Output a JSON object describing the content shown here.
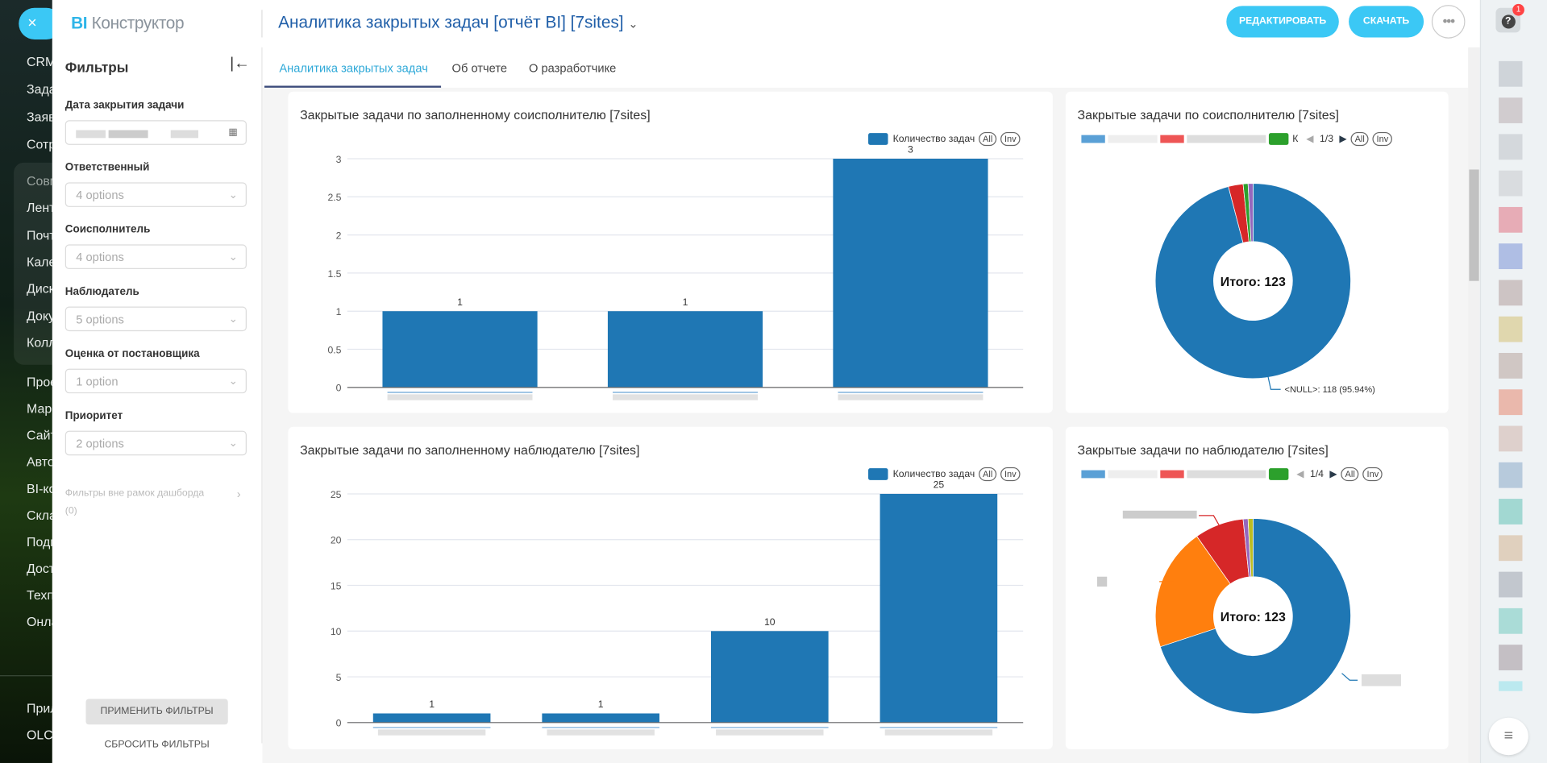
{
  "leftnav": {
    "items_top": [
      "CRM",
      "Задачи",
      "Заявки",
      "Сотрудники"
    ],
    "group": [
      "Совместная",
      "Лента",
      "Почта",
      "Календарь",
      "Диск",
      "Документы",
      "Коллабы"
    ],
    "items": [
      "Проекты",
      "Маркетинг",
      "Сайты",
      "Автоматизация",
      "BI-конструктор",
      "Склад",
      "Подписка",
      "Достижения",
      "Техподдержка",
      "Онлайн"
    ],
    "bottom": [
      "Приложения",
      "OLCHAT"
    ]
  },
  "close_label": "×",
  "app": {
    "logo_bi": "BI",
    "logo_rest": " Конструктор",
    "title": "Аналитика закрытых задач [отчёт BI] [7sites]",
    "edit_label": "РЕДАКТИРОВАТЬ",
    "download_label": "СКАЧАТЬ",
    "more_label": "•••"
  },
  "tabs": [
    {
      "label": "Аналитика закрытых задач",
      "active": true
    },
    {
      "label": "Об отчете"
    },
    {
      "label": "О разработчике"
    }
  ],
  "filters": {
    "title": "Фильтры",
    "fields": [
      {
        "label": "Дата закрытия задачи",
        "value": ""
      },
      {
        "label": "Ответственный",
        "value": "4 options"
      },
      {
        "label": "Соисполнитель",
        "value": "4 options"
      },
      {
        "label": "Наблюдатель",
        "value": "5 options"
      },
      {
        "label": "Оценка от постановщика",
        "value": "1 option"
      },
      {
        "label": "Приоритет",
        "value": "2 options"
      }
    ],
    "outside_label": "Фильтры вне рамок дашборда",
    "outside_count": "(0)",
    "apply_label": "ПРИМЕНИТЬ ФИЛЬТРЫ",
    "reset_label": "СБРОСИТЬ ФИЛЬТРЫ"
  },
  "legend": {
    "series_name": "Количество задач",
    "all": "All",
    "inv": "Inv"
  },
  "rightbar": {
    "badge": "1",
    "help": "?"
  },
  "chart_data": [
    {
      "type": "bar",
      "title": "Закрытые задачи по заполненному соисполнителю [7sites]",
      "categories": [
        "",
        "",
        ""
      ],
      "values": [
        1,
        1,
        3
      ],
      "ylim": [
        0,
        3
      ],
      "yticks": [
        0,
        0.5,
        1,
        1.5,
        2,
        2.5,
        3
      ],
      "color": "#1f77b4",
      "legend": "top-right"
    },
    {
      "type": "pie",
      "title": "Закрытые задачи по соисполнителю [7sites]",
      "total_label": "Итого: 123",
      "page": "1/3",
      "legend_partial": "К",
      "slices": [
        {
          "name": "<NULL>",
          "value": 118,
          "color": "#1f77b4"
        },
        {
          "name": "",
          "value": 3,
          "color": "#d62728"
        },
        {
          "name": "",
          "value": 1,
          "color": "#2ca02c"
        },
        {
          "name": "",
          "value": 1,
          "color": "#9467bd"
        }
      ],
      "annotation": "<NULL>: 118 (95.94%)"
    },
    {
      "type": "bar",
      "title": "Закрытые задачи по заполненному наблюдателю [7sites]",
      "categories": [
        "",
        "",
        "",
        ""
      ],
      "values": [
        1,
        1,
        10,
        25
      ],
      "ylim": [
        0,
        25
      ],
      "yticks": [
        0,
        5,
        10,
        15,
        20,
        25
      ],
      "color": "#1f77b4",
      "legend": "top-right"
    },
    {
      "type": "pie",
      "title": "Закрытые задачи по наблюдателю [7sites]",
      "total_label": "Итого: 123",
      "page": "1/4",
      "slices": [
        {
          "name": "",
          "value": 86,
          "color": "#1f77b4"
        },
        {
          "name": "",
          "value": 25,
          "color": "#ff7f0e"
        },
        {
          "name": "",
          "value": 10,
          "color": "#d62728"
        },
        {
          "name": "",
          "value": 1,
          "color": "#9467bd"
        },
        {
          "name": "",
          "value": 1,
          "color": "#bcbd22"
        }
      ]
    }
  ]
}
